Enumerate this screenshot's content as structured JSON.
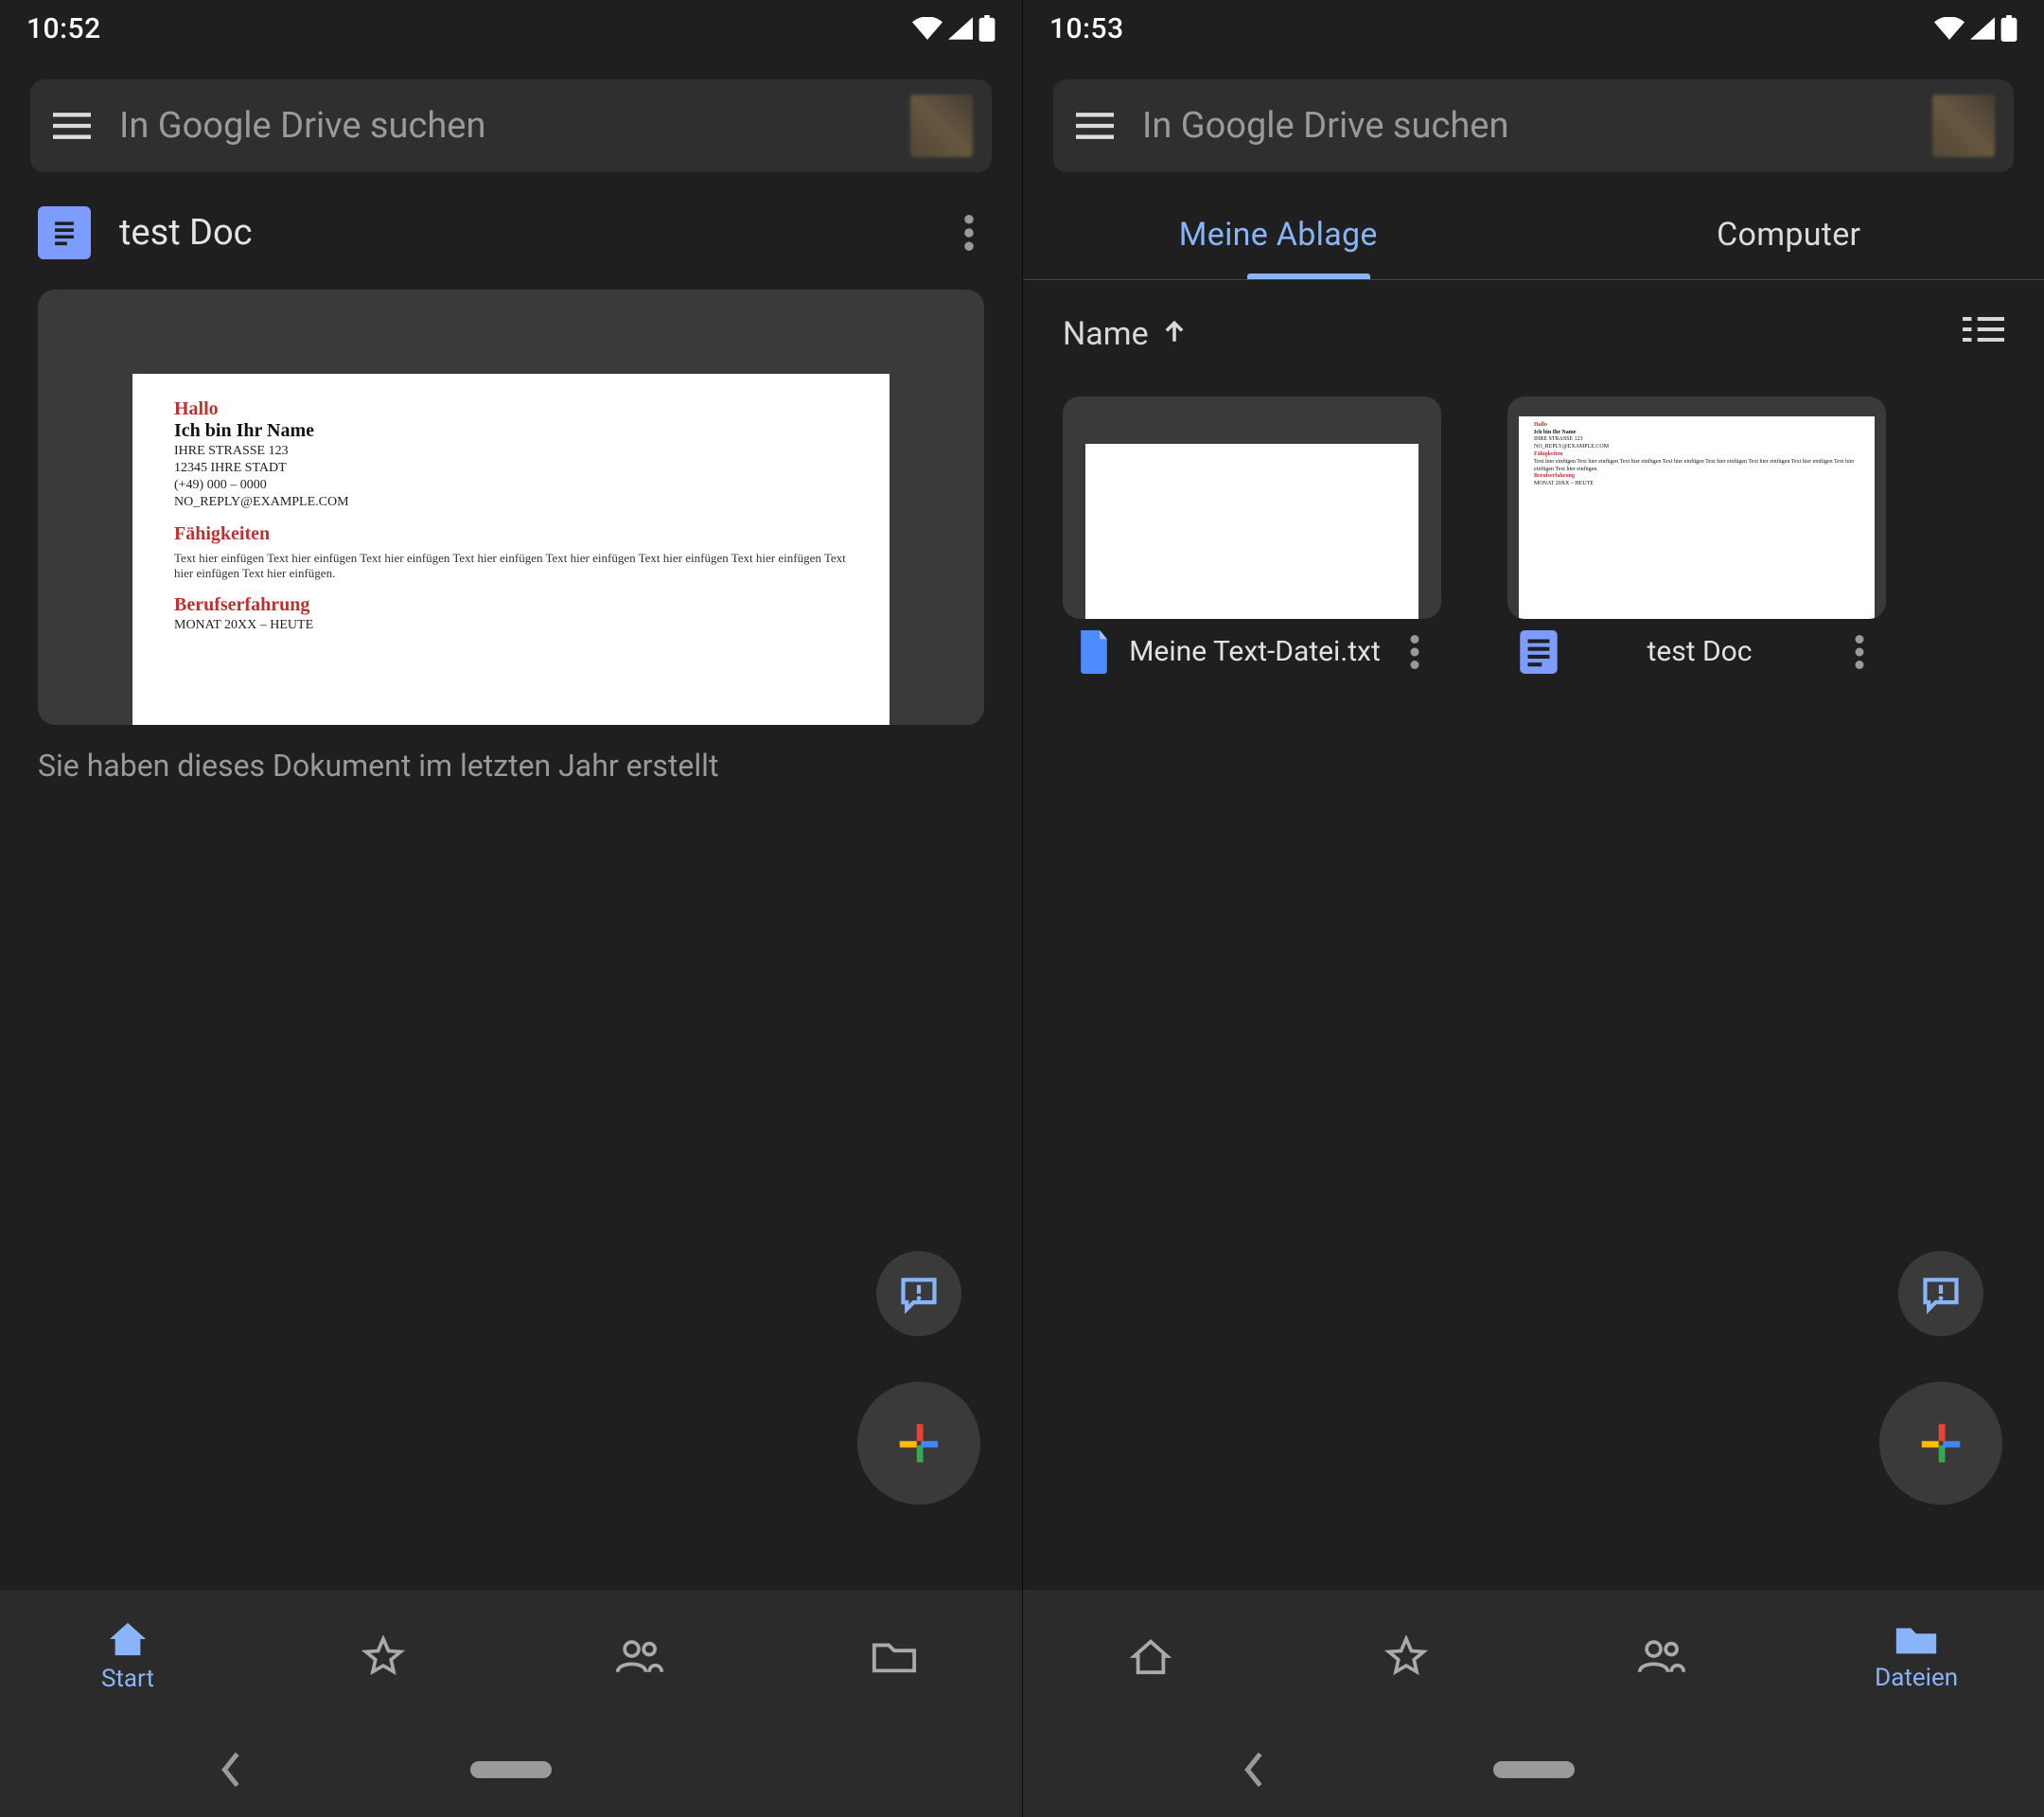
{
  "left": {
    "status_time": "10:52",
    "search_placeholder": "In Google Drive suchen",
    "suggested": {
      "title": "test Doc",
      "subtitle": "Sie haben dieses Dokument im letzten Jahr erstellt"
    },
    "doc_preview": {
      "greeting": "Hallo",
      "name_line": "Ich bin Ihr Name",
      "addr1": "IHRE STRASSE 123",
      "addr2": "12345 IHRE STADT",
      "phone": "(+49) 000 – 0000",
      "email": "NO_REPLY@EXAMPLE.COM",
      "skills_heading": "Fähigkeiten",
      "skills_body": "Text hier einfügen Text hier einfügen Text hier einfügen Text hier einfügen Text hier einfügen Text hier einfügen Text hier einfügen Text hier einfügen Text hier einfügen.",
      "exp_heading": "Berufserfahrung",
      "exp_line": "MONAT 20XX – HEUTE"
    },
    "nav": {
      "start": "Start",
      "favorites": "",
      "shared": "",
      "files": ""
    }
  },
  "right": {
    "status_time": "10:53",
    "search_placeholder": "In Google Drive suchen",
    "tabs": {
      "mydrive": "Meine Ablage",
      "computers": "Computer"
    },
    "sort_label": "Name",
    "files": [
      {
        "name": "Meine Text-Datei.txt",
        "icon": "file"
      },
      {
        "name": "test Doc",
        "icon": "docs"
      }
    ],
    "nav": {
      "home": "",
      "favorites": "",
      "shared": "",
      "files": "Dateien"
    }
  },
  "colors": {
    "accent": "#8ab4f8"
  }
}
